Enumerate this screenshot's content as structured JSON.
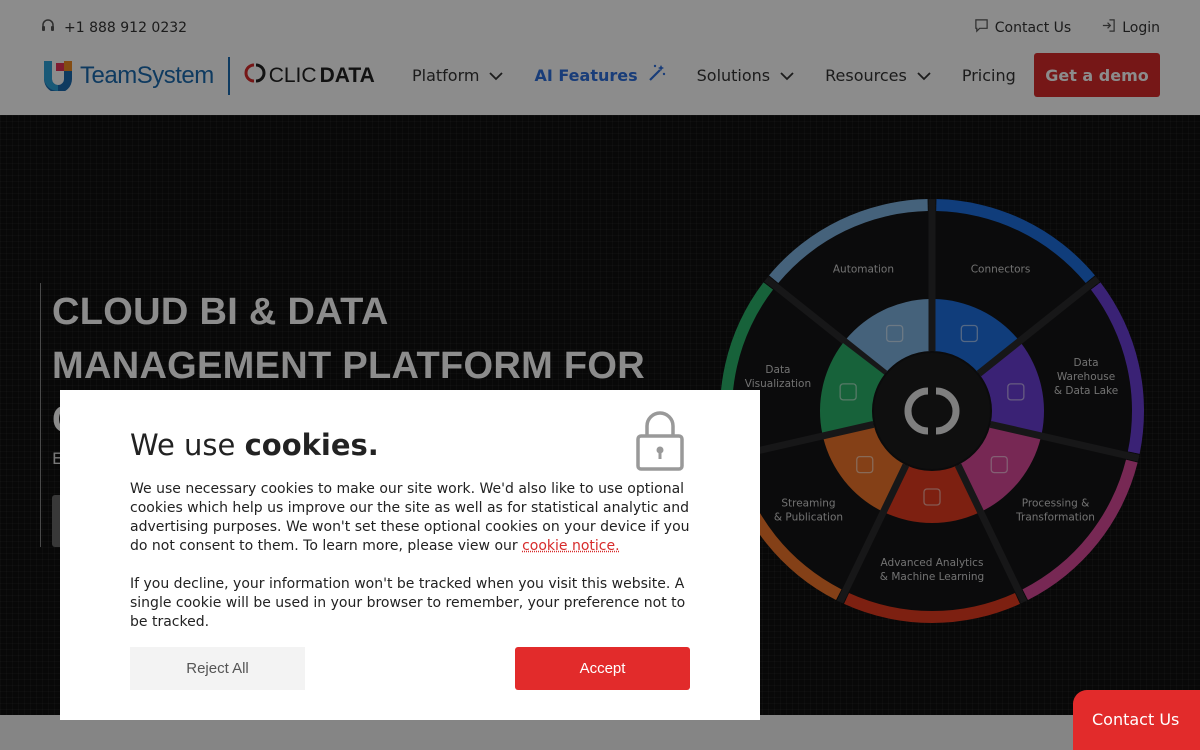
{
  "topbar": {
    "phone": "+1 888 912 0232",
    "contact": "Contact Us",
    "login": "Login"
  },
  "nav": {
    "logo_teamsystem": "TeamSystem",
    "logo_clic": "CLIC",
    "logo_data": "DATA",
    "items": [
      {
        "label": "Platform",
        "dropdown": true
      },
      {
        "label": "AI Features",
        "dropdown": false
      },
      {
        "label": "Solutions",
        "dropdown": true
      },
      {
        "label": "Resources",
        "dropdown": true
      },
      {
        "label": "Pricing",
        "dropdown": false
      }
    ],
    "cta": "Get a demo"
  },
  "hero": {
    "title_line1": "CLOUD BI & DATA",
    "title_line2": "MANAGEMENT PLATFORM FOR",
    "title_line3": "C",
    "sub": "E",
    "wheel": {
      "segments": [
        {
          "label1": "Automation",
          "label2": "",
          "color": "#7fb2e0"
        },
        {
          "label1": "Connectors",
          "label2": "",
          "color": "#1e6fe0"
        },
        {
          "label1": "Data",
          "label2": "Warehouse",
          "label3": "& Data Lake",
          "color": "#6b3fd6"
        },
        {
          "label1": "Processing &",
          "label2": "Transformation",
          "color": "#d94a9a"
        },
        {
          "label1": "Advanced Analytics",
          "label2": "& Machine Learning",
          "color": "#e33b1f"
        },
        {
          "label1": "Streaming",
          "label2": "& Publication",
          "color": "#f0762a"
        },
        {
          "label1": "Data",
          "label2": "Visualization",
          "color": "#2bb36b"
        }
      ]
    }
  },
  "cookie": {
    "title_plain": "We use ",
    "title_bold": "cookies.",
    "p1": "We use necessary cookies to make our site work. We'd also like to use optional cookies which help us improve our the site as well as for statistical analytic and advertising purposes. We won't set these optional cookies on your device if you do not consent to them. To learn more, please view our ",
    "p1_link": "cookie notice.",
    "p2": "If you decline, your information won't be tracked when you visit this website. A single cookie will be used in your browser to remember, your preference not to be tracked.",
    "reject": "Reject All",
    "accept": "Accept"
  },
  "float_contact": "Contact Us",
  "colors": {
    "brand_red": "#d72b2b",
    "ai_blue": "#2f6fdc",
    "teamsystem_blue": "#1a6bb0"
  }
}
